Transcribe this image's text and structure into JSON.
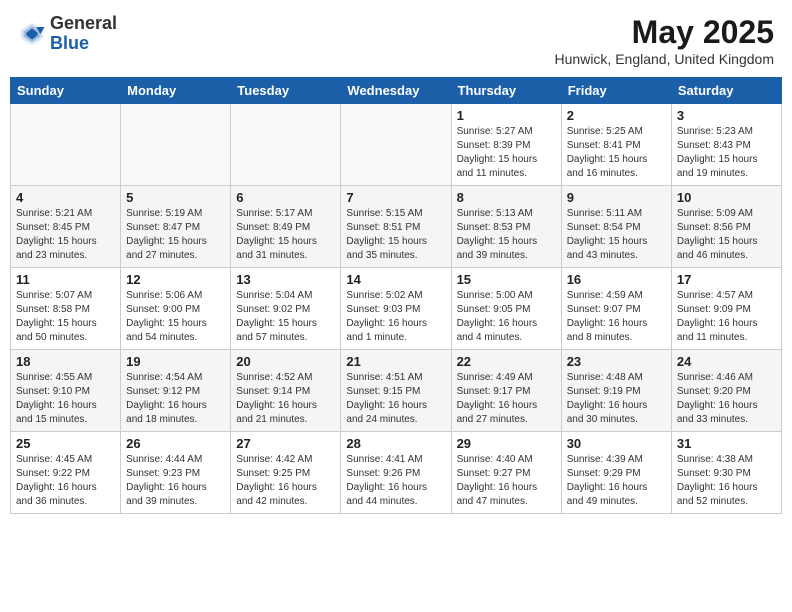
{
  "header": {
    "logo_general": "General",
    "logo_blue": "Blue",
    "month_title": "May 2025",
    "location": "Hunwick, England, United Kingdom"
  },
  "weekdays": [
    "Sunday",
    "Monday",
    "Tuesday",
    "Wednesday",
    "Thursday",
    "Friday",
    "Saturday"
  ],
  "weeks": [
    [
      {
        "day": "",
        "info": ""
      },
      {
        "day": "",
        "info": ""
      },
      {
        "day": "",
        "info": ""
      },
      {
        "day": "",
        "info": ""
      },
      {
        "day": "1",
        "info": "Sunrise: 5:27 AM\nSunset: 8:39 PM\nDaylight: 15 hours\nand 11 minutes."
      },
      {
        "day": "2",
        "info": "Sunrise: 5:25 AM\nSunset: 8:41 PM\nDaylight: 15 hours\nand 16 minutes."
      },
      {
        "day": "3",
        "info": "Sunrise: 5:23 AM\nSunset: 8:43 PM\nDaylight: 15 hours\nand 19 minutes."
      }
    ],
    [
      {
        "day": "4",
        "info": "Sunrise: 5:21 AM\nSunset: 8:45 PM\nDaylight: 15 hours\nand 23 minutes."
      },
      {
        "day": "5",
        "info": "Sunrise: 5:19 AM\nSunset: 8:47 PM\nDaylight: 15 hours\nand 27 minutes."
      },
      {
        "day": "6",
        "info": "Sunrise: 5:17 AM\nSunset: 8:49 PM\nDaylight: 15 hours\nand 31 minutes."
      },
      {
        "day": "7",
        "info": "Sunrise: 5:15 AM\nSunset: 8:51 PM\nDaylight: 15 hours\nand 35 minutes."
      },
      {
        "day": "8",
        "info": "Sunrise: 5:13 AM\nSunset: 8:53 PM\nDaylight: 15 hours\nand 39 minutes."
      },
      {
        "day": "9",
        "info": "Sunrise: 5:11 AM\nSunset: 8:54 PM\nDaylight: 15 hours\nand 43 minutes."
      },
      {
        "day": "10",
        "info": "Sunrise: 5:09 AM\nSunset: 8:56 PM\nDaylight: 15 hours\nand 46 minutes."
      }
    ],
    [
      {
        "day": "11",
        "info": "Sunrise: 5:07 AM\nSunset: 8:58 PM\nDaylight: 15 hours\nand 50 minutes."
      },
      {
        "day": "12",
        "info": "Sunrise: 5:06 AM\nSunset: 9:00 PM\nDaylight: 15 hours\nand 54 minutes."
      },
      {
        "day": "13",
        "info": "Sunrise: 5:04 AM\nSunset: 9:02 PM\nDaylight: 15 hours\nand 57 minutes."
      },
      {
        "day": "14",
        "info": "Sunrise: 5:02 AM\nSunset: 9:03 PM\nDaylight: 16 hours\nand 1 minute."
      },
      {
        "day": "15",
        "info": "Sunrise: 5:00 AM\nSunset: 9:05 PM\nDaylight: 16 hours\nand 4 minutes."
      },
      {
        "day": "16",
        "info": "Sunrise: 4:59 AM\nSunset: 9:07 PM\nDaylight: 16 hours\nand 8 minutes."
      },
      {
        "day": "17",
        "info": "Sunrise: 4:57 AM\nSunset: 9:09 PM\nDaylight: 16 hours\nand 11 minutes."
      }
    ],
    [
      {
        "day": "18",
        "info": "Sunrise: 4:55 AM\nSunset: 9:10 PM\nDaylight: 16 hours\nand 15 minutes."
      },
      {
        "day": "19",
        "info": "Sunrise: 4:54 AM\nSunset: 9:12 PM\nDaylight: 16 hours\nand 18 minutes."
      },
      {
        "day": "20",
        "info": "Sunrise: 4:52 AM\nSunset: 9:14 PM\nDaylight: 16 hours\nand 21 minutes."
      },
      {
        "day": "21",
        "info": "Sunrise: 4:51 AM\nSunset: 9:15 PM\nDaylight: 16 hours\nand 24 minutes."
      },
      {
        "day": "22",
        "info": "Sunrise: 4:49 AM\nSunset: 9:17 PM\nDaylight: 16 hours\nand 27 minutes."
      },
      {
        "day": "23",
        "info": "Sunrise: 4:48 AM\nSunset: 9:19 PM\nDaylight: 16 hours\nand 30 minutes."
      },
      {
        "day": "24",
        "info": "Sunrise: 4:46 AM\nSunset: 9:20 PM\nDaylight: 16 hours\nand 33 minutes."
      }
    ],
    [
      {
        "day": "25",
        "info": "Sunrise: 4:45 AM\nSunset: 9:22 PM\nDaylight: 16 hours\nand 36 minutes."
      },
      {
        "day": "26",
        "info": "Sunrise: 4:44 AM\nSunset: 9:23 PM\nDaylight: 16 hours\nand 39 minutes."
      },
      {
        "day": "27",
        "info": "Sunrise: 4:42 AM\nSunset: 9:25 PM\nDaylight: 16 hours\nand 42 minutes."
      },
      {
        "day": "28",
        "info": "Sunrise: 4:41 AM\nSunset: 9:26 PM\nDaylight: 16 hours\nand 44 minutes."
      },
      {
        "day": "29",
        "info": "Sunrise: 4:40 AM\nSunset: 9:27 PM\nDaylight: 16 hours\nand 47 minutes."
      },
      {
        "day": "30",
        "info": "Sunrise: 4:39 AM\nSunset: 9:29 PM\nDaylight: 16 hours\nand 49 minutes."
      },
      {
        "day": "31",
        "info": "Sunrise: 4:38 AM\nSunset: 9:30 PM\nDaylight: 16 hours\nand 52 minutes."
      }
    ]
  ],
  "colors": {
    "header_bg": "#1a5fa8",
    "row_alt_bg": "#f0f0f0",
    "row_bg": "#ffffff"
  }
}
